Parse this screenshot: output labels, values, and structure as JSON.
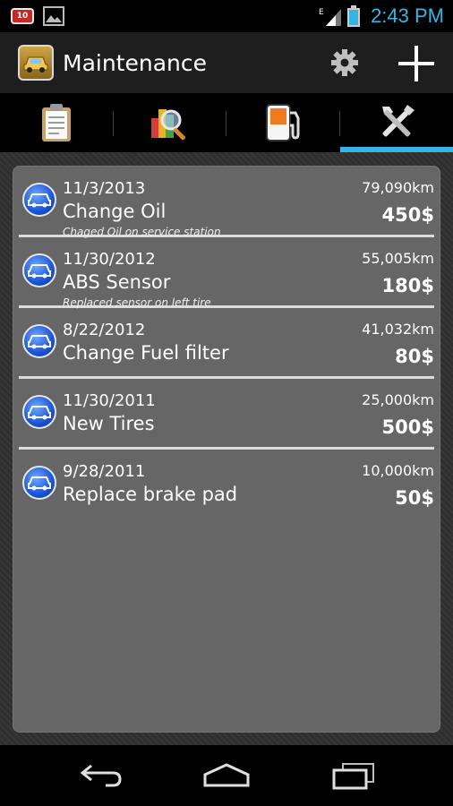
{
  "status_bar": {
    "notification_count": "10",
    "network": "E",
    "time": "2:43 PM"
  },
  "action_bar": {
    "title": "Maintenance",
    "icons": [
      "app-car-icon",
      "gear-icon",
      "plus-icon"
    ]
  },
  "tabs": [
    {
      "name": "log",
      "icon": "clipboard-icon",
      "active": false
    },
    {
      "name": "reports",
      "icon": "chart-magnifier-icon",
      "active": false
    },
    {
      "name": "fuel",
      "icon": "fuel-pump-icon",
      "active": false
    },
    {
      "name": "maintenance",
      "icon": "tools-icon",
      "active": true
    }
  ],
  "records": [
    {
      "date": "11/3/2013",
      "title": "Change Oil",
      "note": "Chaged Oil on service station",
      "odometer": "79,090km",
      "cost": "450$"
    },
    {
      "date": "11/30/2012",
      "title": "ABS Sensor",
      "note": "Replaced sensor on left tire",
      "odometer": "55,005km",
      "cost": "180$"
    },
    {
      "date": "8/22/2012",
      "title": "Change Fuel filter",
      "note": "",
      "odometer": "41,032km",
      "cost": "80$"
    },
    {
      "date": "11/30/2011",
      "title": "New Tires",
      "note": "",
      "odometer": "25,000km",
      "cost": "500$"
    },
    {
      "date": "9/28/2011",
      "title": "Replace brake pad",
      "note": "",
      "odometer": "10,000km",
      "cost": "50$"
    }
  ],
  "colors": {
    "accent": "#33b5e5",
    "card_bg": "#666666",
    "icon_blue": "#1a55d8"
  }
}
